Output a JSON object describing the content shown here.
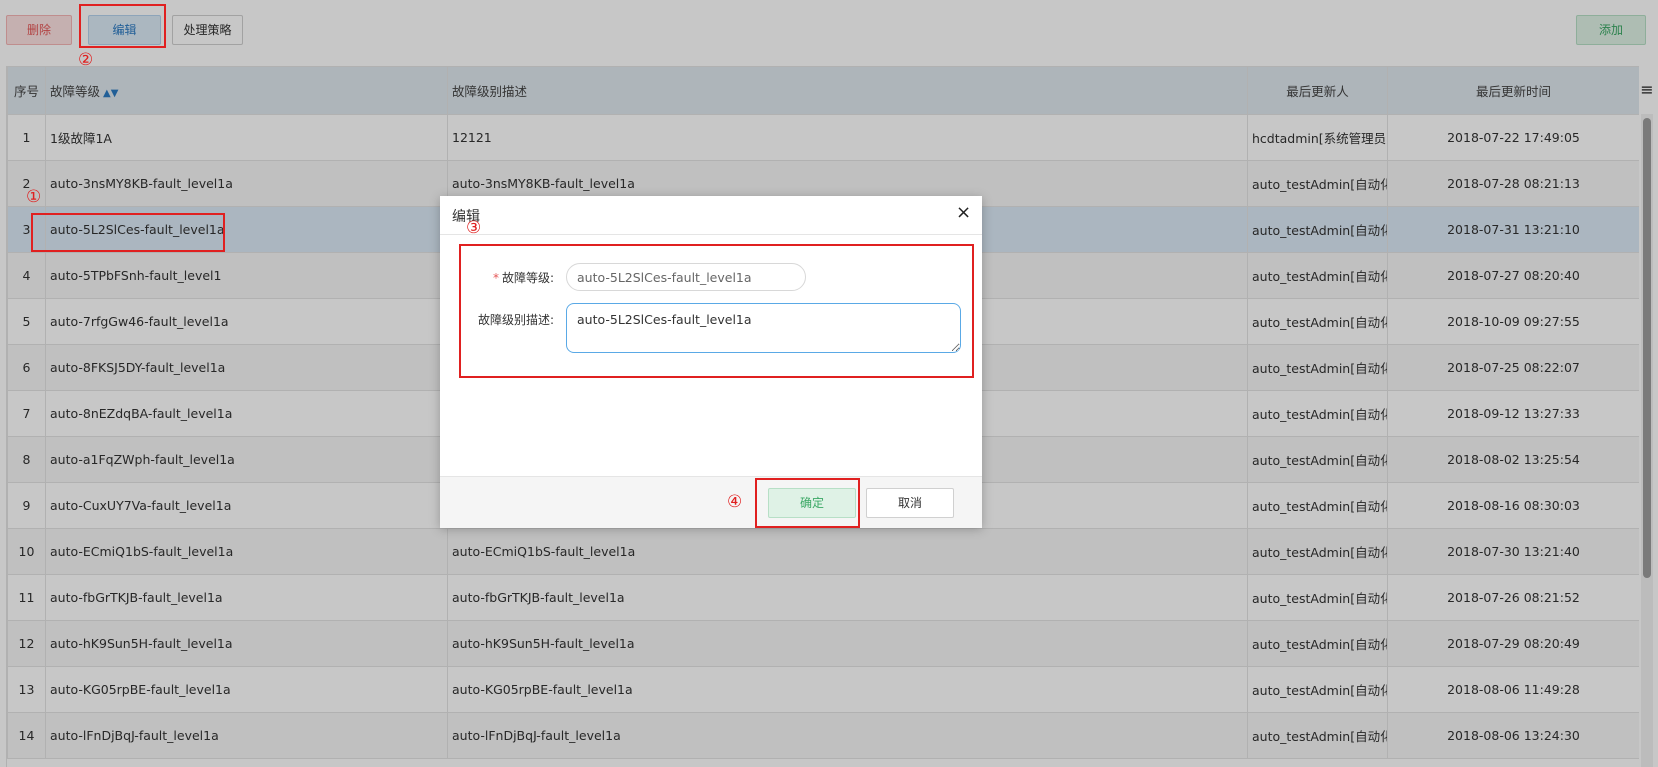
{
  "toolbar": {
    "delete_label": "删除",
    "edit_label": "编辑",
    "policy_label": "处理策略",
    "add_label": "添加"
  },
  "table": {
    "columns": [
      "序号",
      "故障等级",
      "故障级别描述",
      "最后更新人",
      "最后更新时间"
    ],
    "rows": [
      {
        "idx": "1",
        "level": "1级故障1A",
        "desc": "12121",
        "updater": "hcdtadmin[系统管理员]",
        "time": "2018-07-22 17:49:05"
      },
      {
        "idx": "2",
        "level": "auto-3nsMY8KB-fault_level1a",
        "desc": "auto-3nsMY8KB-fault_level1a",
        "updater": "auto_testAdmin[自动化测",
        "time": "2018-07-28 08:21:13"
      },
      {
        "idx": "3",
        "level": "auto-5L2SlCes-fault_level1a",
        "desc": "",
        "updater": "auto_testAdmin[自动化测",
        "time": "2018-07-31 13:21:10"
      },
      {
        "idx": "4",
        "level": "auto-5TPbFSnh-fault_level1",
        "desc": "",
        "updater": "auto_testAdmin[自动化测",
        "time": "2018-07-27 08:20:40"
      },
      {
        "idx": "5",
        "level": "auto-7rfgGw46-fault_level1a",
        "desc": "",
        "updater": "auto_testAdmin[自动化测",
        "time": "2018-10-09 09:27:55"
      },
      {
        "idx": "6",
        "level": "auto-8FKSJ5DY-fault_level1a",
        "desc": "",
        "updater": "auto_testAdmin[自动化测",
        "time": "2018-07-25 08:22:07"
      },
      {
        "idx": "7",
        "level": "auto-8nEZdqBA-fault_level1a",
        "desc": "",
        "updater": "auto_testAdmin[自动化测",
        "time": "2018-09-12 13:27:33"
      },
      {
        "idx": "8",
        "level": "auto-a1FqZWph-fault_level1a",
        "desc": "",
        "updater": "auto_testAdmin[自动化测",
        "time": "2018-08-02 13:25:54"
      },
      {
        "idx": "9",
        "level": "auto-CuxUY7Va-fault_level1a",
        "desc": "",
        "updater": "auto_testAdmin[自动化测",
        "time": "2018-08-16 08:30:03"
      },
      {
        "idx": "10",
        "level": "auto-ECmiQ1bS-fault_level1a",
        "desc": "auto-ECmiQ1bS-fault_level1a",
        "updater": "auto_testAdmin[自动化测",
        "time": "2018-07-30 13:21:40"
      },
      {
        "idx": "11",
        "level": "auto-fbGrTKJB-fault_level1a",
        "desc": "auto-fbGrTKJB-fault_level1a",
        "updater": "auto_testAdmin[自动化测",
        "time": "2018-07-26 08:21:52"
      },
      {
        "idx": "12",
        "level": "auto-hK9Sun5H-fault_level1a",
        "desc": "auto-hK9Sun5H-fault_level1a",
        "updater": "auto_testAdmin[自动化测",
        "time": "2018-07-29 08:20:49"
      },
      {
        "idx": "13",
        "level": "auto-KG05rpBE-fault_level1a",
        "desc": "auto-KG05rpBE-fault_level1a",
        "updater": "auto_testAdmin[自动化测",
        "time": "2018-08-06 11:49:28"
      },
      {
        "idx": "14",
        "level": "auto-lFnDjBqJ-fault_level1a",
        "desc": "auto-lFnDjBqJ-fault_level1a",
        "updater": "auto_testAdmin[自动化测",
        "time": "2018-08-06 13:24:30"
      }
    ]
  },
  "dialog": {
    "title": "编辑",
    "close_icon": "×",
    "required_mark": "*",
    "level_label": "故障等级:",
    "level_value": "auto-5L2SlCes-fault_level1a",
    "desc_label": "故障级别描述:",
    "desc_value": "auto-5L2SlCes-fault_level1a",
    "ok_label": "确定",
    "cancel_label": "取消"
  },
  "annotations": {
    "m1": "①",
    "m2": "②",
    "m3": "③",
    "m4": "④",
    "color": "#e02020"
  },
  "icons": {
    "sort": "sort-icon",
    "column_menu": "menu-icon",
    "close": "close-icon"
  },
  "selected_row": 3
}
